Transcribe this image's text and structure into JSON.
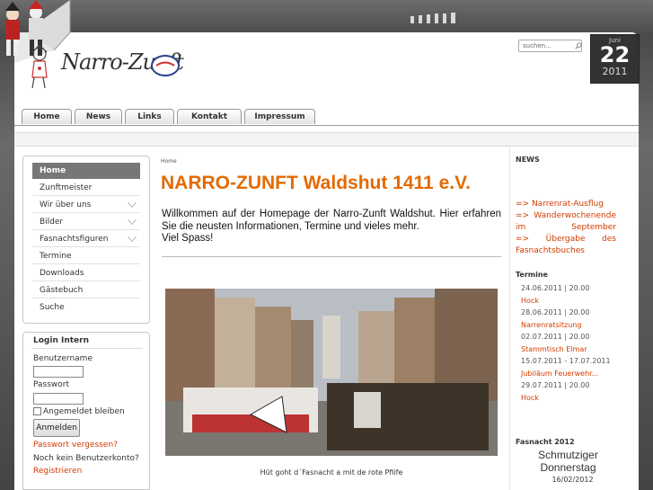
{
  "site": {
    "logo_text": "Narro-Zunft",
    "title": "NARRO-ZUNFT Waldshut 1411 e.V."
  },
  "search": {
    "placeholder": "suchen..."
  },
  "date": {
    "month": "Juni",
    "day": "22",
    "year": "2011"
  },
  "tabs": [
    "Home",
    "News",
    "Links",
    "Kontakt",
    "Impressum"
  ],
  "menu": {
    "items": [
      {
        "label": "Home",
        "active": true
      },
      {
        "label": "Zunftmeister"
      },
      {
        "label": "Wir über uns",
        "submenu": true
      },
      {
        "label": "Bilder",
        "submenu": true
      },
      {
        "label": "Fasnachtsfiguren",
        "submenu": true
      },
      {
        "label": "Termine"
      },
      {
        "label": "Downloads"
      },
      {
        "label": "Gästebuch"
      },
      {
        "label": "Suche"
      }
    ]
  },
  "login": {
    "title": "Login Intern",
    "username_label": "Benutzername",
    "password_label": "Passwort",
    "remember_label": "Angemeldet bleiben",
    "submit_label": "Anmelden",
    "forgot_link": "Passwort vergessen?",
    "no_account": "Noch kein Benutzerkonto?",
    "register_link": "Registrieren"
  },
  "main": {
    "breadcrumb": "Home",
    "intro_line1": "Willkommen auf der Homepage der Narro-Zunft Waldshut. Hier erfahren Sie die neusten Informationen, Termine und vieles mehr.",
    "intro_line2": "Viel Spass!",
    "photo_caption": "Hüt goht d´Fasnacht a mit de rote Pfiife"
  },
  "news": {
    "heading": "NEWS",
    "items": [
      "=> Narrenrat-Ausflug",
      "=> Wanderwochenende im September",
      "=> Übergabe des Fasnachtsbuches"
    ]
  },
  "termine": {
    "heading": "Termine",
    "items": [
      {
        "date": "24.06.2011 | 20.00",
        "title": "Hock"
      },
      {
        "date": "28.06.2011 | 20.00",
        "title": "Narrenratsitzung"
      },
      {
        "date": "02.07.2011 | 20.00",
        "title": "Stammtisch Elmar"
      },
      {
        "date": "15.07.2011 - 17.07.2011",
        "title": "Jubiläum Feuerwehr..."
      },
      {
        "date": "29.07.2011 | 20.00",
        "title": "Hock"
      }
    ]
  },
  "fasnacht": {
    "heading": "Fasnacht 2012",
    "event": "Schmutziger Donnerstag",
    "date": "16/02/2012"
  },
  "colors": {
    "accent": "#e46a00",
    "link": "#d33b00",
    "page_bg": "#5b5b5b",
    "date_bg": "#333333"
  }
}
